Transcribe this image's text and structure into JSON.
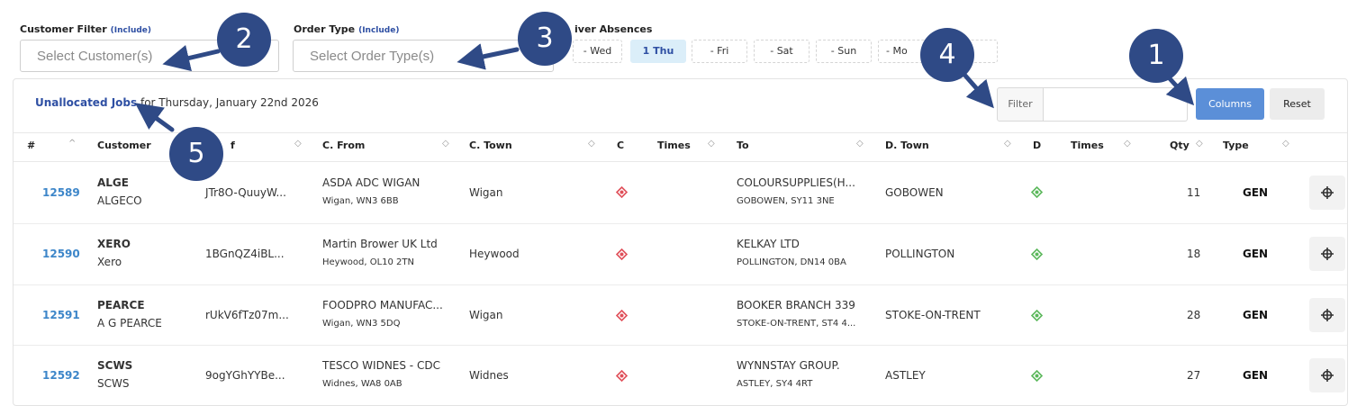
{
  "filters": {
    "customer_label": "Customer Filter",
    "customer_include": "(Include)",
    "customer_placeholder": "Select Customer(s)",
    "order_label": "Order Type",
    "order_include": "(Include)",
    "order_placeholder": "Select Order Type(s)",
    "absence_label": "iver Absences"
  },
  "days": [
    "- Wed",
    "1 Thu",
    "- Fri",
    "- Sat",
    "- Sun",
    "- Mo"
  ],
  "active_day": "1 Thu",
  "panel": {
    "title_link": "Unallocated Jobs",
    "title_rest": " for Thursday, January 22nd 2026",
    "filter_label": "Filter",
    "filter_value": "",
    "columns_button": "Columns",
    "reset_button": "Reset"
  },
  "columns": [
    "#",
    "Customer",
    "f",
    "C. From",
    "C. Town",
    "C",
    "Times",
    "To",
    "D. Town",
    "D",
    "Times",
    "Qty",
    "Type"
  ],
  "rows": [
    {
      "id": "12589",
      "code": "ALGE",
      "name": "ALGECO",
      "ref": "JTr8O-QuuyW...",
      "from_name": "ASDA ADC WIGAN",
      "from_addr": "Wigan, WN3 6BB",
      "c_town": "Wigan",
      "to_name": "COLOURSUPPLIES(H...",
      "to_addr": "GOBOWEN, SY11 3NE",
      "d_town": "GOBOWEN",
      "qty": "11",
      "type": "GEN"
    },
    {
      "id": "12590",
      "code": "XERO",
      "name": "Xero",
      "ref": "1BGnQZ4iBL...",
      "from_name": "Martin Brower UK Ltd",
      "from_addr": "Heywood, OL10 2TN",
      "c_town": "Heywood",
      "to_name": "KELKAY LTD",
      "to_addr": "POLLINGTON, DN14 0BA",
      "d_town": "POLLINGTON",
      "qty": "18",
      "type": "GEN"
    },
    {
      "id": "12591",
      "code": "PEARCE",
      "name": "A G PEARCE",
      "ref": "rUkV6fTz07m...",
      "from_name": "FOODPRO MANUFAC...",
      "from_addr": "Wigan, WN3 5DQ",
      "c_town": "Wigan",
      "to_name": "BOOKER BRANCH 339",
      "to_addr": "STOKE-ON-TRENT, ST4 4...",
      "d_town": "STOKE-ON-TRENT",
      "qty": "28",
      "type": "GEN"
    },
    {
      "id": "12592",
      "code": "SCWS",
      "name": "SCWS",
      "ref": "9ogYGhYYBe...",
      "from_name": "TESCO WIDNES - CDC",
      "from_addr": "Widnes, WA8 0AB",
      "c_town": "Widnes",
      "to_name": "WYNNSTAY GROUP.",
      "to_addr": "ASTLEY, SY4 4RT",
      "d_town": "ASTLEY",
      "qty": "27",
      "type": "GEN"
    }
  ],
  "callouts": [
    "1",
    "2",
    "3",
    "4",
    "5"
  ],
  "colors": {
    "accent": "#5b8fd8",
    "link": "#3d86c9",
    "badge": "#2f4a86",
    "collect_marker": "#e0505a",
    "deliver_marker": "#5cb85c"
  }
}
